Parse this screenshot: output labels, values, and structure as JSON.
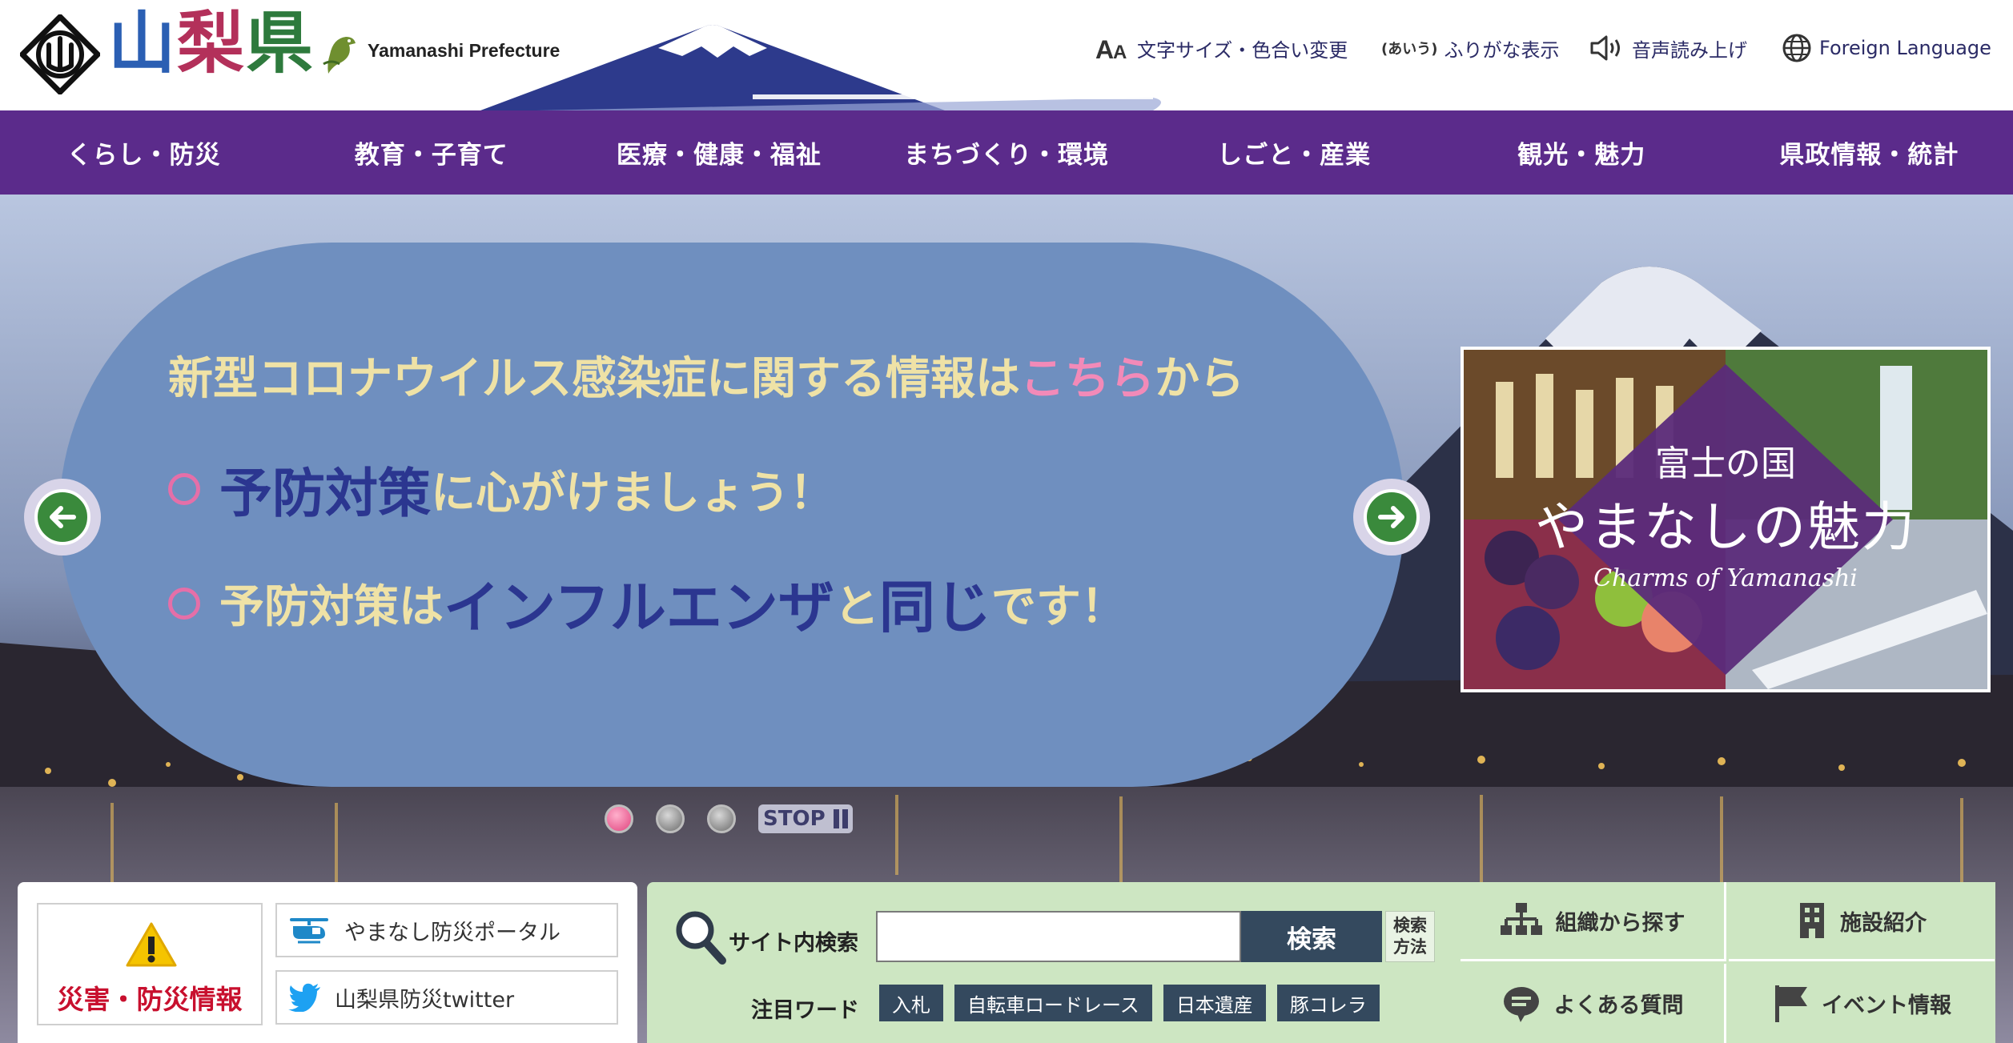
{
  "header": {
    "logo_kanji": [
      "山",
      "梨",
      "県"
    ],
    "logo_english": "Yamanashi Prefecture",
    "utility": {
      "text_size": "文字サイズ・色合い変更",
      "furigana_badge": "(あいう)",
      "furigana": "ふりがな表示",
      "voice": "音声読み上げ",
      "foreign": "Foreign Language"
    }
  },
  "nav": {
    "items": [
      {
        "label": "くらし・防災"
      },
      {
        "label": "教育・子育て"
      },
      {
        "label": "医療・健康・福祉"
      },
      {
        "label": "まちづくり・環境"
      },
      {
        "label": "しごと・産業"
      },
      {
        "label": "観光・魅力"
      },
      {
        "label": "県政情報・統計"
      }
    ]
  },
  "slider": {
    "line1_pre": "新型コロナウイルス感染症に関する情報は",
    "line1_highlight": "こちら",
    "line1_post": "から",
    "line2_big": "予防対策",
    "line2_rest": "に心がけましょう！",
    "line3_a": "予防対策は",
    "line3_big1": "インフルエンザ",
    "line3_b": "と",
    "line3_big2": "同じ",
    "line3_c": "です！",
    "stop_label": "STOP",
    "active_slide": 1,
    "total_slides": 3
  },
  "banner": {
    "title_small": "富士の国",
    "title_large": "やまなしの魅力",
    "subtitle": "Charms of Yamanashi"
  },
  "disaster": {
    "label": "災害・防災情報",
    "portal_label": "やまなし防災ポータル",
    "twitter_label": "山梨県防災twitter"
  },
  "search": {
    "label": "サイト内検索",
    "value": "",
    "button_label": "検索",
    "method_label": "検索方法",
    "hot_label": "注目ワード",
    "hot_words": [
      "入札",
      "自転車ロードレース",
      "日本遺産",
      "豚コレラ"
    ]
  },
  "quick_links": {
    "org": "組織から探す",
    "facility": "施設紹介",
    "faq": "よくある質問",
    "event": "イベント情報"
  },
  "colors": {
    "nav_bg": "#5b2b8b",
    "slide_pill": "#6f8fbf",
    "search_panel": "#cde6c2",
    "search_button": "#34495e",
    "disaster_red": "#c8102e"
  }
}
